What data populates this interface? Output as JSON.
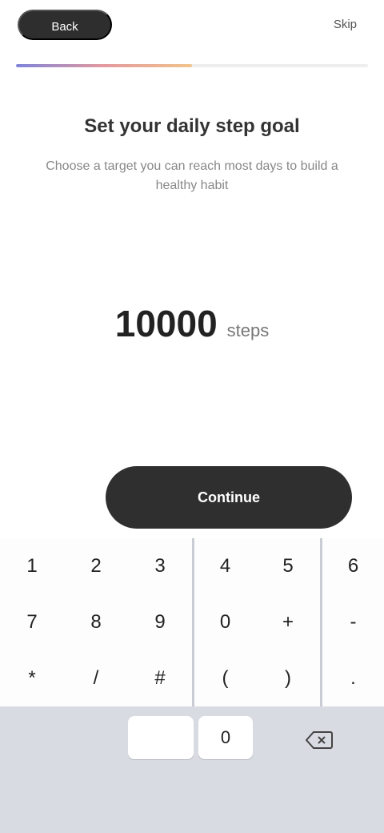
{
  "header": {
    "back_label": "Back",
    "skip_label": "Skip",
    "progress_fraction": 0.5,
    "progress_colors": [
      "#7e84d9",
      "#e49a9f",
      "#f0c48c"
    ]
  },
  "main": {
    "title": "Set your daily step goal",
    "subtitle": "Choose a target you can reach most days to build a healthy habit",
    "amount_value": "10000",
    "amount_unit": "steps",
    "left_hint": "",
    "continue_label": "Continue"
  },
  "keyboard": {
    "rows": [
      [
        "1",
        "2",
        "3",
        "4",
        "5",
        "6"
      ],
      [
        "7",
        "8",
        "9",
        "0",
        "+",
        "-"
      ],
      [
        "*",
        "/",
        "#",
        "(",
        ")",
        "."
      ]
    ],
    "bottom_left": "",
    "bottom_mid": "0",
    "delete_icon": "backspace-icon"
  },
  "colors": {
    "button_dark": "#2f2f2f",
    "keyboard_bg": "#d8dbe2"
  }
}
